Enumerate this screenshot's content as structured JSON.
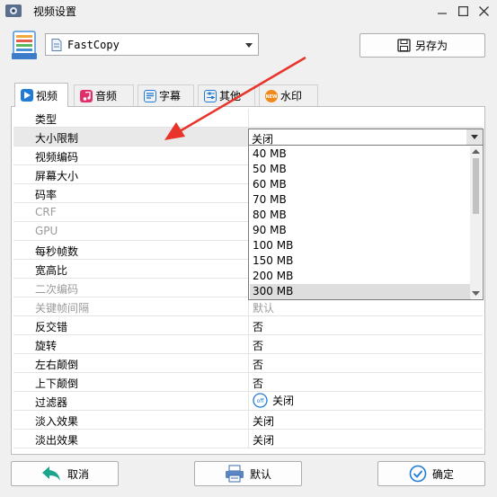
{
  "window": {
    "title": "视频设置"
  },
  "preset": {
    "value": "FastCopy"
  },
  "toolbar": {
    "save_as_label": "另存为"
  },
  "tabs": [
    {
      "label": "视频",
      "icon": "play-icon",
      "active": true
    },
    {
      "label": "音频",
      "icon": "music-note-icon",
      "active": false
    },
    {
      "label": "字幕",
      "icon": "subtitle-icon",
      "active": false
    },
    {
      "label": "其他",
      "icon": "sliders-icon",
      "active": false
    },
    {
      "label": "水印",
      "icon": "new-badge-icon",
      "active": false
    }
  ],
  "properties": [
    {
      "key": "类型",
      "value": "",
      "disabled": false
    },
    {
      "key": "大小限制",
      "value": "关闭",
      "disabled": false,
      "selected": true
    },
    {
      "key": "视频编码",
      "value": "",
      "disabled": false
    },
    {
      "key": "屏幕大小",
      "value": "",
      "disabled": false
    },
    {
      "key": "码率",
      "value": "",
      "disabled": false
    },
    {
      "key": "CRF",
      "value": "",
      "disabled": true
    },
    {
      "key": "GPU",
      "value": "",
      "disabled": true
    },
    {
      "key": "每秒帧数",
      "value": "",
      "disabled": false
    },
    {
      "key": "宽高比",
      "value": "",
      "disabled": false
    },
    {
      "key": "二次编码",
      "value": "",
      "disabled": true
    },
    {
      "key": "关键帧间隔",
      "value": "默认",
      "disabled": true
    },
    {
      "key": "反交错",
      "value": "否",
      "disabled": false
    },
    {
      "key": "旋转",
      "value": "否",
      "disabled": false
    },
    {
      "key": "左右颠倒",
      "value": "否",
      "disabled": false
    },
    {
      "key": "上下颠倒",
      "value": "否",
      "disabled": false
    },
    {
      "key": "过滤器",
      "value": "关闭",
      "disabled": false,
      "toggle": "off"
    },
    {
      "key": "淡入效果",
      "value": "关闭",
      "disabled": false
    },
    {
      "key": "淡出效果",
      "value": "关闭",
      "disabled": false
    }
  ],
  "size_limit_dropdown": {
    "selected": "关闭",
    "options": [
      "40 MB",
      "50 MB",
      "60 MB",
      "70 MB",
      "80 MB",
      "90 MB",
      "100 MB",
      "150 MB",
      "200 MB",
      "300 MB"
    ],
    "highlighted": "300 MB"
  },
  "toggle_text": "off",
  "footer": {
    "cancel_label": "取消",
    "default_label": "默认",
    "ok_label": "确定"
  },
  "colors": {
    "accent": "#1f7bd6",
    "arrow": "#e8342b",
    "tab_music": "#e0306b",
    "tab_new": "#f08a1c"
  }
}
